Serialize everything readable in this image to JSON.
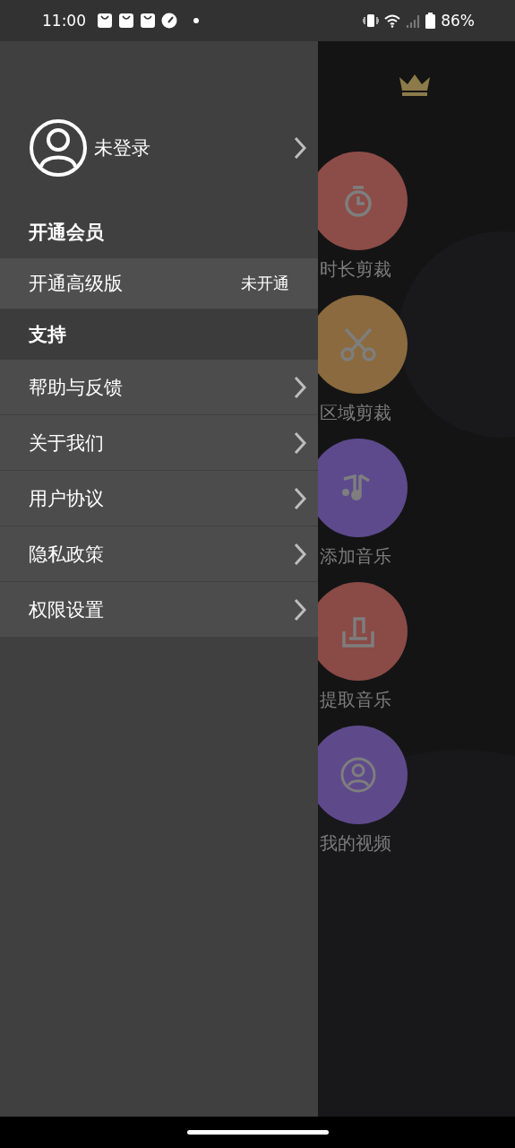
{
  "status_bar": {
    "time": "11:00",
    "battery": "86%"
  },
  "drawer": {
    "profile": {
      "name": "未登录"
    },
    "sections": [
      {
        "title": "开通会员",
        "items": [
          {
            "kind": "value",
            "label": "开通高级版",
            "value": "未开通"
          }
        ]
      },
      {
        "title": "支持",
        "items": [
          {
            "kind": "link",
            "label": "帮助与反馈"
          },
          {
            "kind": "link",
            "label": "关于我们"
          },
          {
            "kind": "link",
            "label": "用户协议"
          },
          {
            "kind": "link",
            "label": "隐私政策"
          },
          {
            "kind": "link",
            "label": "权限设置"
          }
        ]
      }
    ]
  },
  "tools": [
    {
      "kind": "timer",
      "label": "时长剪裁",
      "color": "#8c4c48"
    },
    {
      "kind": "scissors",
      "label": "区域剪裁",
      "color": "#8a6a3e"
    },
    {
      "kind": "music",
      "label": "添加音乐",
      "color": "#5c4a8c"
    },
    {
      "kind": "extract",
      "label": "提取音乐",
      "color": "#8a4a46"
    },
    {
      "kind": "person",
      "label": "我的视频",
      "color": "#5e4a8a"
    }
  ]
}
